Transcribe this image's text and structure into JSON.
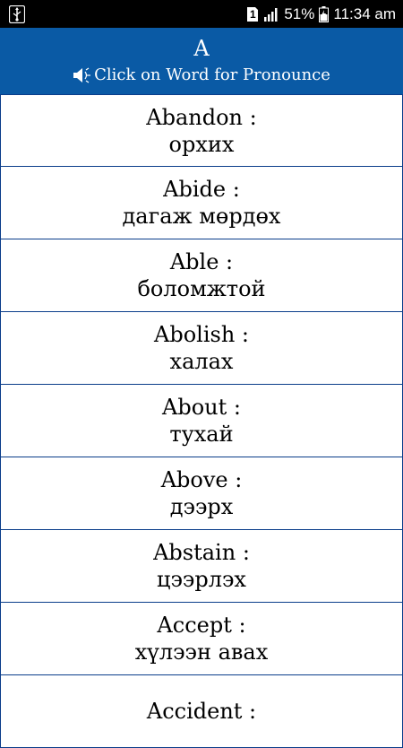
{
  "status_bar": {
    "sim_label": "1",
    "battery": "51%",
    "time": "11:34 am"
  },
  "header": {
    "title": "A",
    "subtitle": "Click on Word for Pronounce"
  },
  "words": [
    {
      "en": "Abandon :",
      "mn": "орхих"
    },
    {
      "en": "Abide :",
      "mn": "дагаж мөрдөх"
    },
    {
      "en": "Able :",
      "mn": "боломжтой"
    },
    {
      "en": "Abolish :",
      "mn": "халах"
    },
    {
      "en": "About :",
      "mn": "тухай"
    },
    {
      "en": "Above :",
      "mn": "дээрх"
    },
    {
      "en": "Abstain :",
      "mn": "цээрлэх"
    },
    {
      "en": "Accept :",
      "mn": "хүлээн авах"
    },
    {
      "en": "Accident :",
      "mn": ""
    }
  ],
  "colors": {
    "header_bg": "#0a5aa5",
    "row_border": "#0a3d8a"
  },
  "icons": {
    "usb": "usb-icon",
    "sim": "sim-icon",
    "signal": "signal-icon",
    "battery": "battery-icon",
    "speaker": "speaker-icon"
  }
}
